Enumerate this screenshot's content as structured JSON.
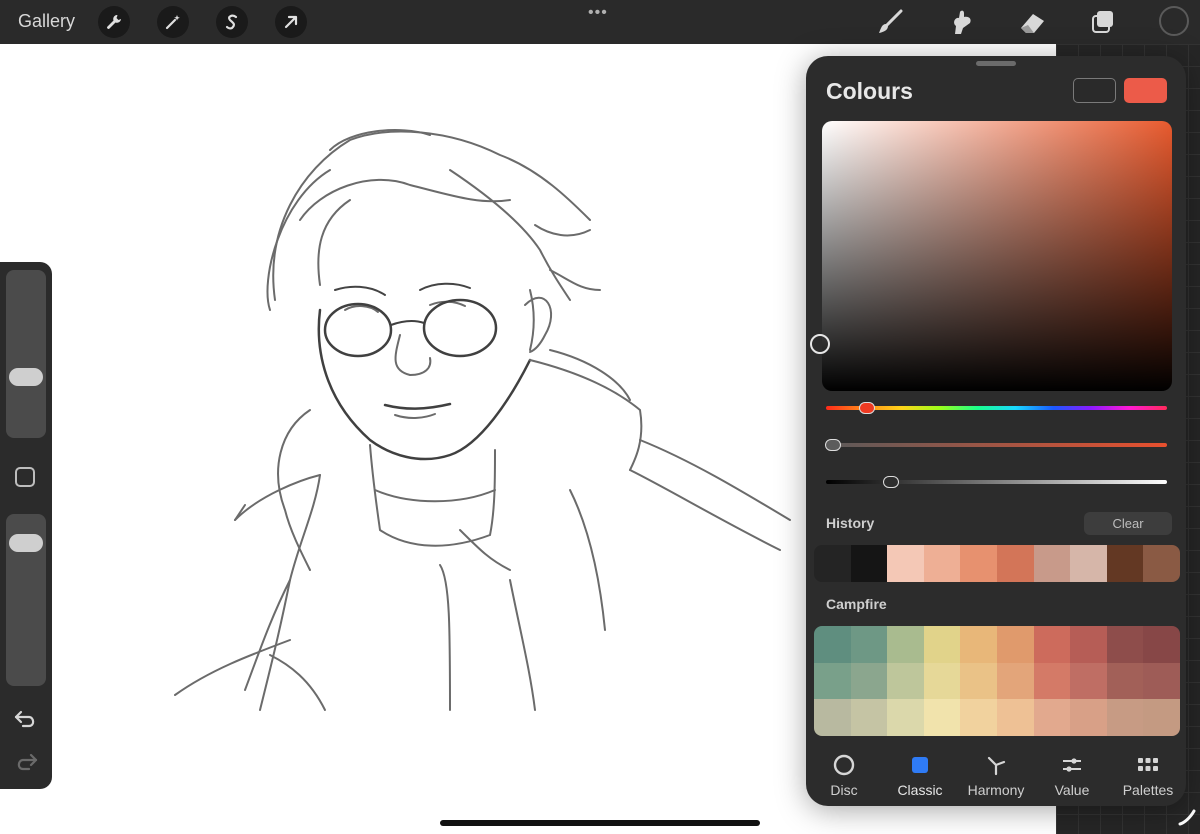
{
  "toolbar": {
    "gallery_label": "Gallery",
    "more_dots": "•••",
    "left_tools": [
      "wrench-icon",
      "magic-wand-icon",
      "selection-icon",
      "transform-arrow-icon"
    ],
    "right_tools": [
      "brush-icon",
      "smudge-icon",
      "eraser-icon",
      "layers-icon"
    ],
    "current_color": "#2a2a2a"
  },
  "sidebar": {
    "size_level": 0.38,
    "opacity_level": 0.84
  },
  "colours": {
    "title": "Colours",
    "previous_color": "#2a2a2a",
    "current_color": "#ec5b49",
    "sliders": {
      "hue_level": 0.12,
      "saturation_level": 0.02,
      "brightness_level": 0.19
    },
    "history_label": "History",
    "clear_label": "Clear",
    "history": [
      "#242424",
      "#151515",
      "#f4c8b6",
      "#eeaf95",
      "#e7916f",
      "#d37558",
      "#c89a8a",
      "#d6b6a9",
      "#633823",
      "#8a5a44"
    ],
    "palette_name": "Campfire",
    "palette": [
      "#5f8e7f",
      "#6e9885",
      "#a9bb8f",
      "#e1d38a",
      "#e8b779",
      "#e09a6c",
      "#cd6b5c",
      "#b65d56",
      "#8e4d4b",
      "#874747",
      "#79a08a",
      "#8ba68e",
      "#bec69b",
      "#e6d898",
      "#eac287",
      "#e3a57a",
      "#d47a67",
      "#bf6e64",
      "#a26058",
      "#9e5c57",
      "#b8b9a0",
      "#c5c4a4",
      "#dbd8ab",
      "#f1e3ac",
      "#f1d29e",
      "#eec195",
      "#e2a98e",
      "#d8a087",
      "#c79b84",
      "#c49a82"
    ],
    "tabs": [
      {
        "label": "Disc",
        "icon": "disc-icon",
        "active": false
      },
      {
        "label": "Classic",
        "icon": "classic-square-icon",
        "active": true
      },
      {
        "label": "Harmony",
        "icon": "harmony-icon",
        "active": false
      },
      {
        "label": "Value",
        "icon": "value-sliders-icon",
        "active": false
      },
      {
        "label": "Palettes",
        "icon": "palettes-grid-icon",
        "active": false
      }
    ],
    "accent": "#2f7bf5"
  }
}
